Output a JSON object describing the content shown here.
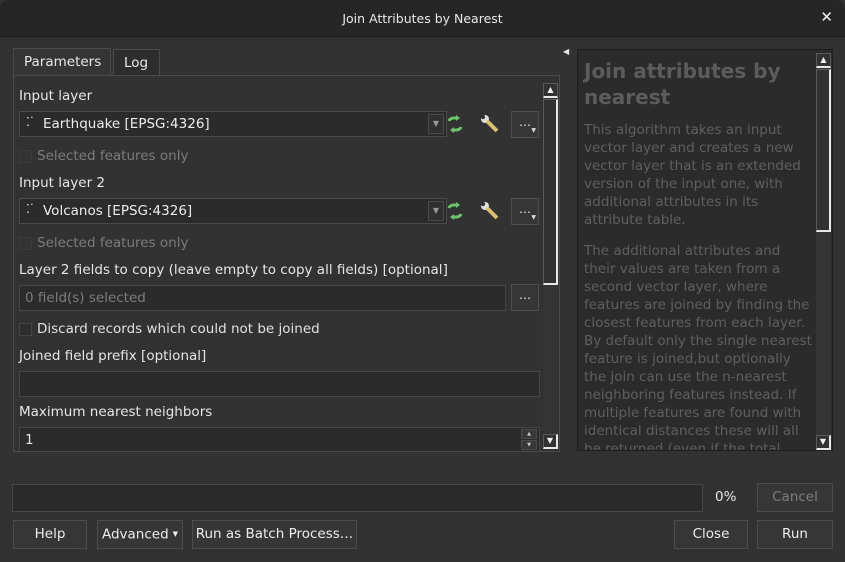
{
  "window": {
    "title": "Join Attributes by Nearest",
    "close_glyph": "✕"
  },
  "tabs": [
    {
      "label": "Parameters",
      "active": true
    },
    {
      "label": "Log",
      "active": false
    }
  ],
  "parameters": {
    "input_layer": {
      "label": "Input layer",
      "value": "Earthquake [EPSG:4326]",
      "layer_icon": "point-layer-icon",
      "selected_only_label": "Selected features only",
      "selected_only_checked": false
    },
    "input_layer_2": {
      "label": "Input layer 2",
      "value": "Volcanos [EPSG:4326]",
      "layer_icon": "point-layer-icon",
      "selected_only_label": "Selected features only",
      "selected_only_checked": false
    },
    "fields_to_copy": {
      "label": "Layer 2 fields to copy (leave empty to copy all fields) [optional]",
      "value": "0 field(s) selected"
    },
    "discard": {
      "label": "Discard records which could not be joined",
      "checked": false
    },
    "prefix": {
      "label": "Joined field prefix [optional]",
      "value": ""
    },
    "max_neighbors": {
      "label": "Maximum nearest neighbors",
      "value": "1"
    },
    "ellipsis": "…",
    "icons": {
      "iterate": "iterate-icon",
      "settings": "wrench-icon"
    }
  },
  "help": {
    "title": "Join attributes by nearest",
    "paragraphs": [
      "This algorithm takes an input vector layer and creates a new vector layer that is an extended version of the input one, with additional attributes in its attribute table.",
      "The additional attributes and their values are taken from a second vector layer, where features are joined by finding the closest features from each layer. By default only the single nearest feature is joined,but optionally the join can use the n-nearest neighboring features instead. If multiple features are found with identical distances these will all be returned (even if the total"
    ]
  },
  "progress": {
    "value_percent": 0,
    "label": "0%"
  },
  "buttons": {
    "cancel": "Cancel",
    "help": "Help",
    "advanced": "Advanced",
    "batch": "Run as Batch Process…",
    "close": "Close",
    "run": "Run"
  }
}
